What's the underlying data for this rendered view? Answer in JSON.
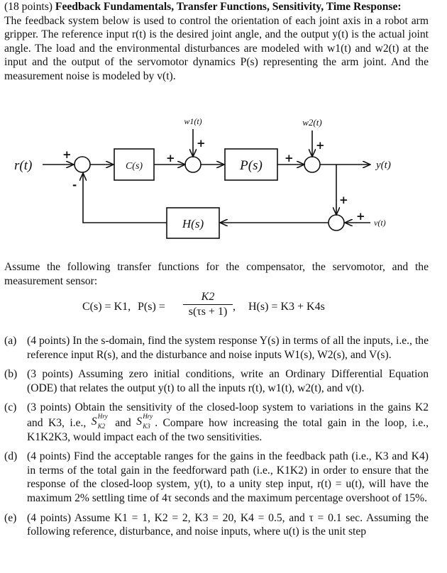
{
  "problem": {
    "points_label": "(18 points)",
    "title": "Feedback Fundamentals, Transfer Functions, Sensitivity, Time Response:",
    "intro": "The feedback system below is used to control the orientation of each joint axis in a robot arm gripper. The reference input r(t) is the desired joint angle, and the output y(t) is the actual joint angle. The load and the environmental disturbances are modeled with w1(t) and w2(t) at the input and the output of the servomotor dynamics P(s) representing the arm joint. And the measurement noise is modeled by v(t)."
  },
  "diagram": {
    "input_label": "r(t)",
    "output_label": "y(t)",
    "blocks": {
      "compensator": "C(s)",
      "plant": "P(s)",
      "sensor": "H(s)"
    },
    "disturbances": {
      "w1": "w1(t)",
      "w2": "w2(t)",
      "noise": "v(t)"
    },
    "signs": {
      "plus": "+",
      "minus": "-"
    }
  },
  "assumption": {
    "text": "Assume the following transfer functions for the compensator, the servomotor, and the measurement sensor:",
    "C": "C(s) = K1,",
    "P_lhs": "P(s) =",
    "P_num": "K2",
    "P_den": "s(τs + 1)",
    "P_comma": ",",
    "H": "H(s) = K3 + K4s"
  },
  "parts": [
    {
      "label": "(a)",
      "text": "(4 points) In the s-domain, find the system response Y(s) in terms of all the inputs, i.e., the reference input R(s), and the disturbance and noise inputs W1(s), W2(s), and V(s)."
    },
    {
      "label": "(b)",
      "text": "(3 points) Assuming zero initial conditions, write an Ordinary Differential Equation (ODE) that relates the output y(t) to all the inputs r(t), w1(t), w2(t), and v(t)."
    },
    {
      "label": "(c)",
      "text_1": "(3 points) Obtain the sensitivity of the closed-loop system to variations in the gains K2 and K3, i.e.,",
      "sens_sup": "Hry",
      "sens_sub_1": "K2",
      "sens_sub_2": "K3",
      "and": "and",
      "text_2": ". Compare how increasing the total gain in the loop, i.e., K1K2K3, would impact each of the two sensitivities."
    },
    {
      "label": "(d)",
      "text": "(4 points) Find the acceptable ranges for the gains in the feedback path (i.e., K3 and K4) in terms of the total gain in the feedforward path (i.e., K1K2) in order to ensure that the response of the closed-loop system, y(t), to a unity step input, r(t) = u(t), will have the maximum 2% settling time of 4τ seconds and the maximum percentage overshoot of 15%."
    },
    {
      "label": "(e)",
      "text": "(4 points) Assume K1 = 1, K2 = 2, K3 = 20, K4 = 0.5, and τ = 0.1 sec. Assuming the following reference, disturbance, and noise inputs, where u(t) is the unit step"
    }
  ]
}
